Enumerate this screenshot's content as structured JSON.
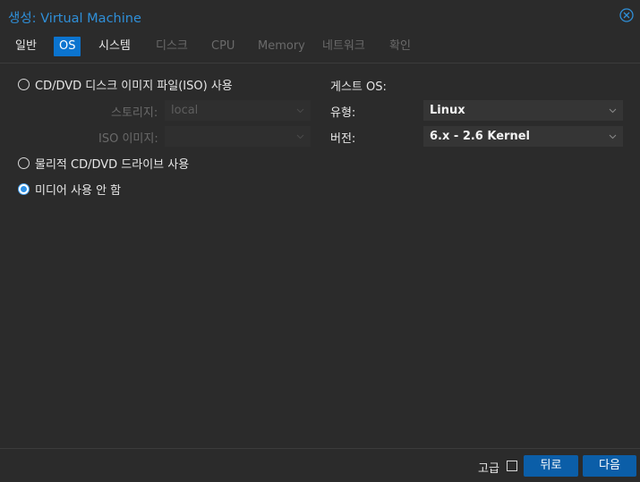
{
  "dialog": {
    "title_prefix": "생성:",
    "title_object": "Virtual Machine"
  },
  "tabs": [
    {
      "label": "일반",
      "state": "normal"
    },
    {
      "label": "OS",
      "state": "active"
    },
    {
      "label": "시스템",
      "state": "normal"
    },
    {
      "label": "디스크",
      "state": "disabled"
    },
    {
      "label": "CPU",
      "state": "disabled"
    },
    {
      "label": "Memory",
      "state": "disabled"
    },
    {
      "label": "네트워크",
      "state": "disabled"
    },
    {
      "label": "확인",
      "state": "disabled"
    }
  ],
  "media": {
    "iso_option": {
      "label": "CD/DVD 디스크 이미지 파일(ISO) 사용",
      "checked": false
    },
    "storage": {
      "label": "스토리지:",
      "value": "local",
      "disabled": true
    },
    "iso_image": {
      "label": "ISO 이미지:",
      "value": "",
      "disabled": true
    },
    "physical_option": {
      "label": "물리적 CD/DVD 드라이브 사용",
      "checked": false
    },
    "none_option": {
      "label": "미디어 사용 안 함",
      "checked": true
    }
  },
  "guest_os": {
    "heading": "게스트 OS:",
    "type": {
      "label": "유형:",
      "value": "Linux"
    },
    "version": {
      "label": "버전:",
      "value": "6.x - 2.6 Kernel"
    }
  },
  "footer": {
    "advanced_label": "고급",
    "advanced_checked": false,
    "back_label": "뒤로",
    "next_label": "다음"
  },
  "colors": {
    "accent": "#0b74cf",
    "button": "#0b5ea8",
    "title": "#2f8fd8",
    "background": "#2b2b2b"
  }
}
